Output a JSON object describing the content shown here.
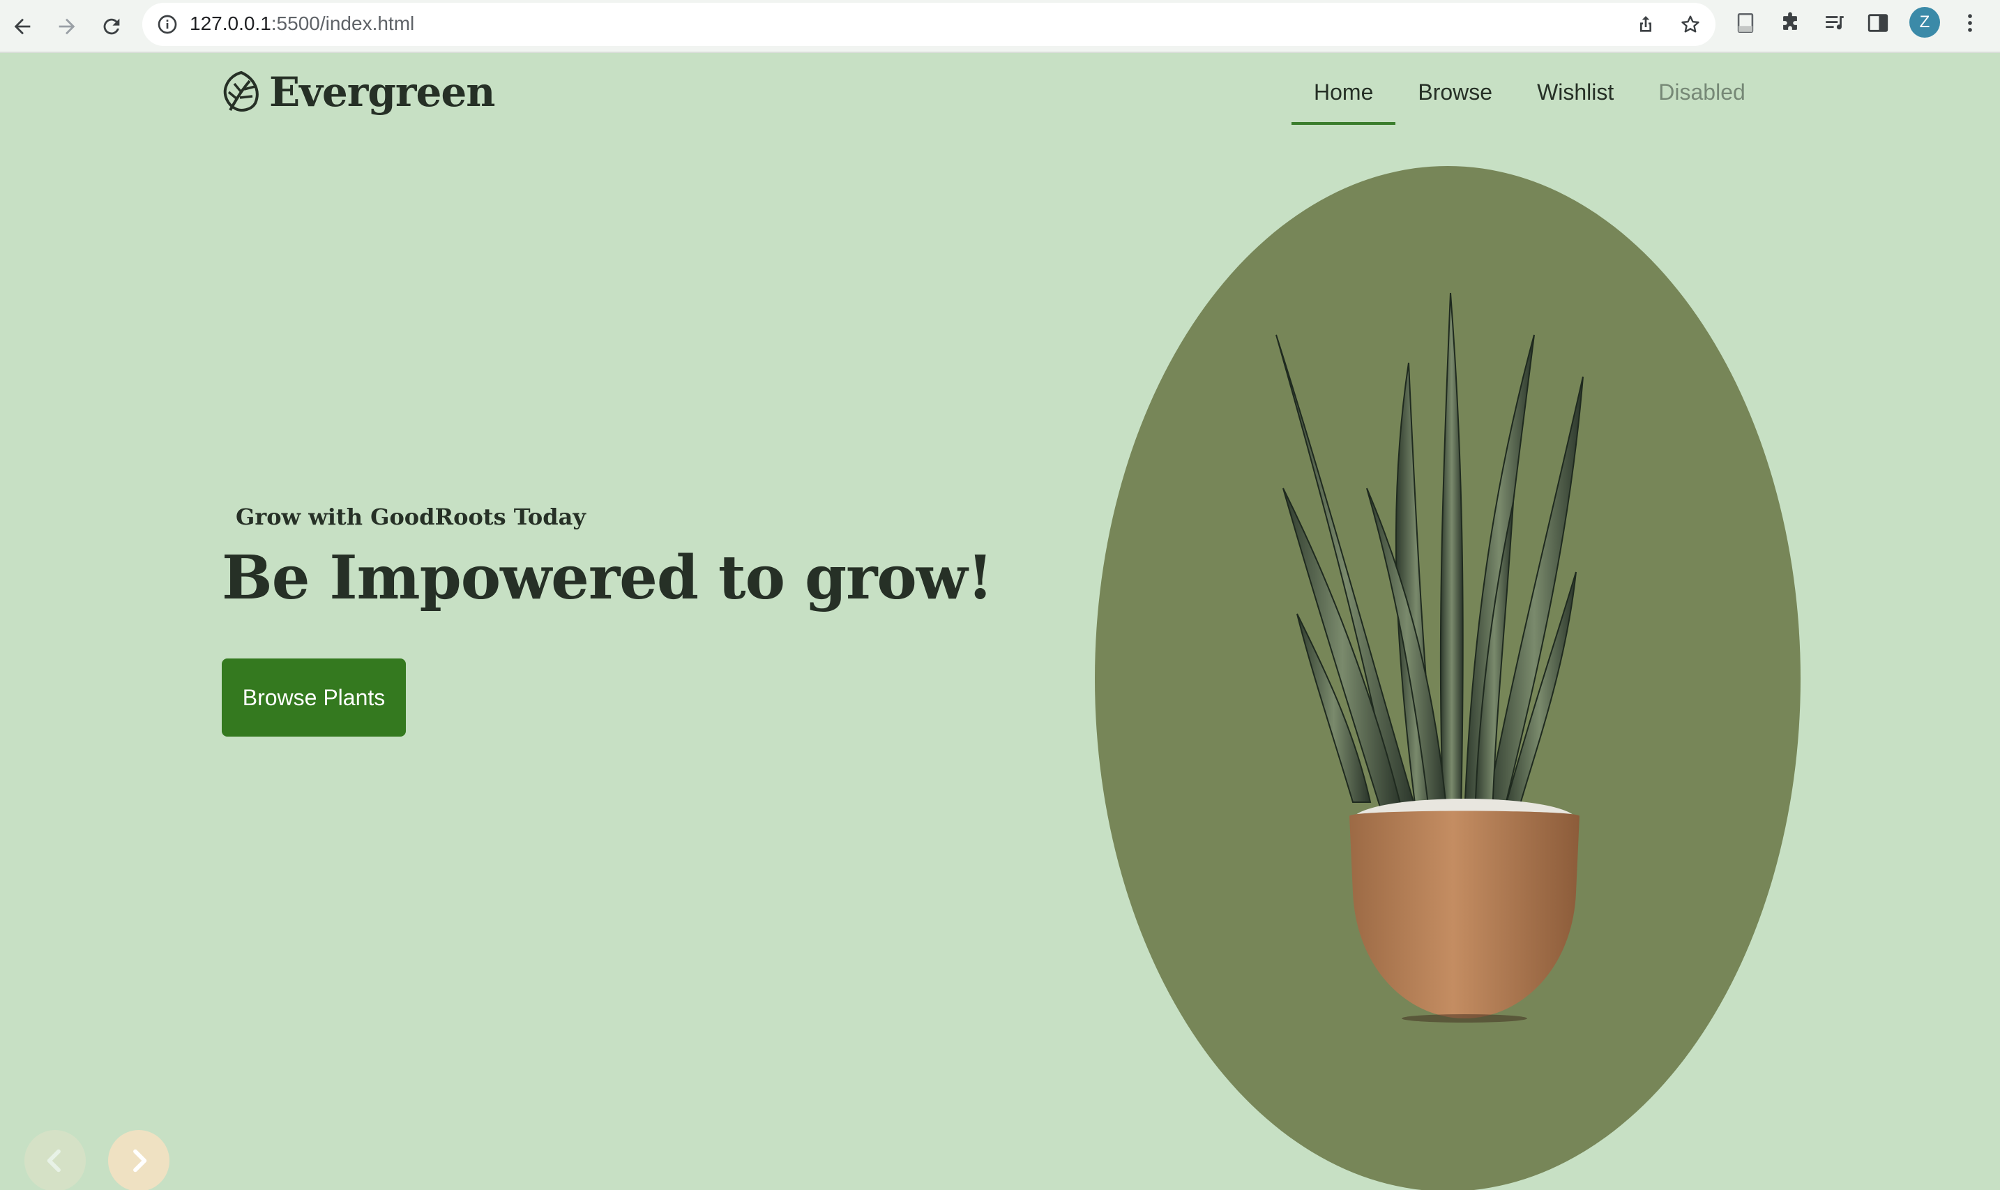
{
  "browser": {
    "url_host": "127.0.0.1",
    "url_rest": ":5500/index.html",
    "profile_initial": "Z",
    "icons": [
      "back-arrow-icon",
      "forward-arrow-icon",
      "reload-icon",
      "site-info-icon",
      "share-icon",
      "bookmark-star-icon",
      "document-icon",
      "extensions-puzzle-icon",
      "media-queue-icon",
      "side-panel-icon",
      "kebab-menu-icon"
    ]
  },
  "site": {
    "logo_text": "Evergreen",
    "nav": [
      {
        "label": "Home",
        "state": "active"
      },
      {
        "label": "Browse",
        "state": "normal"
      },
      {
        "label": "Wishlist",
        "state": "normal"
      },
      {
        "label": "Disabled",
        "state": "disabled"
      }
    ]
  },
  "hero": {
    "eyebrow": "Grow with GoodRoots Today",
    "title": "Be Impowered to grow!",
    "cta_label": "Browse Plants",
    "image_subject": "snake plant in terracotta pot"
  },
  "carousel": {
    "prev_icon": "chevron-left-icon",
    "next_icon": "chevron-right-icon"
  },
  "colors": {
    "page_background": "#c7e0c4",
    "accent_green": "#34791f",
    "oval_background": "#778658",
    "text_dark": "#263026"
  }
}
